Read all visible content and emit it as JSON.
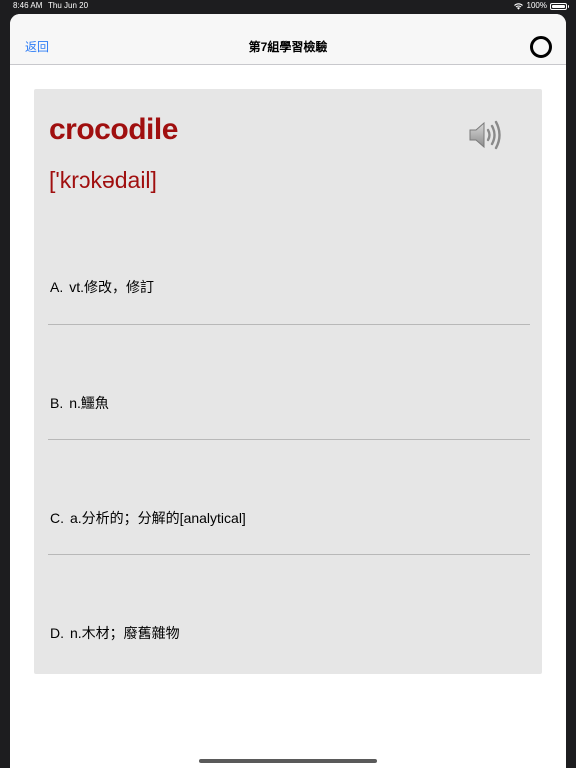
{
  "status_bar": {
    "time": "8:46 AM",
    "date": "Thu Jun 20",
    "battery": "100%"
  },
  "nav": {
    "back_label": "返回",
    "title": "第7組學習檢驗"
  },
  "card": {
    "word": "crocodile",
    "phonetic": "['krɔkədail]",
    "options": [
      {
        "letter": "A.",
        "text": "vt.修改，修訂"
      },
      {
        "letter": "B.",
        "text": "n.鱷魚"
      },
      {
        "letter": "C.",
        "text": "a.分析的；分解的[analytical]"
      },
      {
        "letter": "D.",
        "text": "n.木材；廢舊雜物"
      }
    ]
  },
  "colors": {
    "accent": "#2d7cf6",
    "word": "#a00f0f",
    "card_bg": "#e6e6e6"
  }
}
